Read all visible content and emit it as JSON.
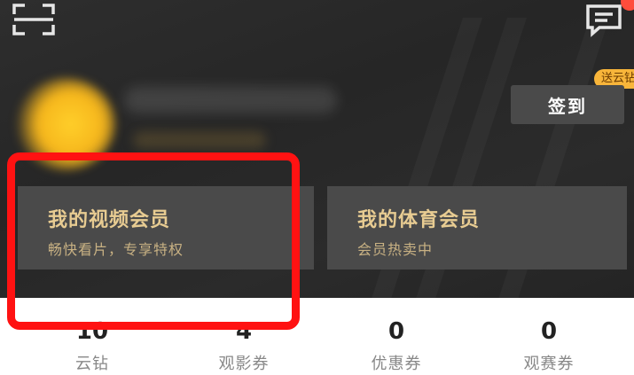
{
  "header": {
    "signin_label": "签到",
    "promo_tag": "送云钻",
    "scan_icon": "scan-icon",
    "message_icon": "message-icon"
  },
  "cards": [
    {
      "title": "我的视频会员",
      "subtitle": "畅快看片，专享特权"
    },
    {
      "title": "我的体育会员",
      "subtitle": "会员热卖中"
    }
  ],
  "stats": [
    {
      "value": "10",
      "label": "云钻"
    },
    {
      "value": "4",
      "label": "观影券"
    },
    {
      "value": "0",
      "label": "优惠券"
    },
    {
      "value": "0",
      "label": "观赛券"
    }
  ],
  "colors": {
    "header_bg": "#2b2b2b",
    "card_bg": "#4a4a4a",
    "gold_text": "#e8cc92",
    "highlight_red": "#ff1212"
  }
}
